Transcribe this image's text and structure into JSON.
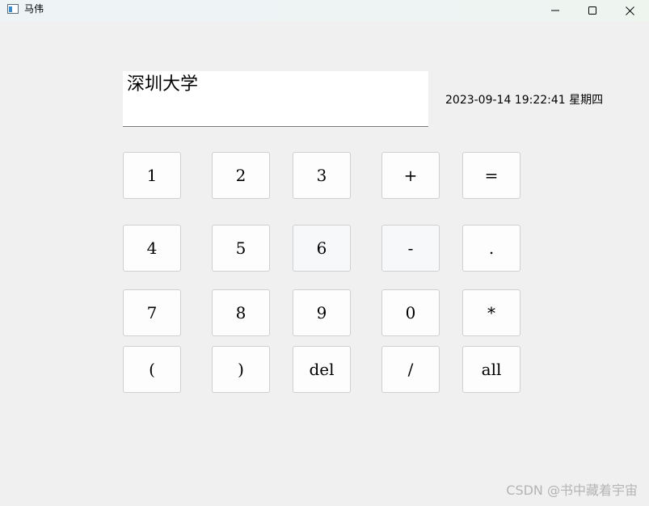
{
  "window": {
    "title": "马伟",
    "icon": "app-window-icon",
    "controls": [
      "minimize-icon",
      "maximize-icon",
      "close-icon"
    ]
  },
  "display": {
    "text": "深圳大学"
  },
  "clock": {
    "text": "2023-09-14 19:22:41 星期四"
  },
  "keys": {
    "k1": "1",
    "k2": "2",
    "k3": "3",
    "plus": "+",
    "equals": "=",
    "k4": "4",
    "k5": "5",
    "k6": "6",
    "minus": "-",
    "dot": ".",
    "k7": "7",
    "k8": "8",
    "k9": "9",
    "k0": "0",
    "multiply": "*",
    "lparen": "(",
    "rparen": ")",
    "del": "del",
    "divide": "/",
    "all": "all"
  },
  "watermark": "CSDN @书中藏着宇宙",
  "colors": {
    "background": "#f0f0f0",
    "key": "#fdfdfd",
    "key_border": "#d0d0d0",
    "watermark": "#b4b4b4"
  }
}
